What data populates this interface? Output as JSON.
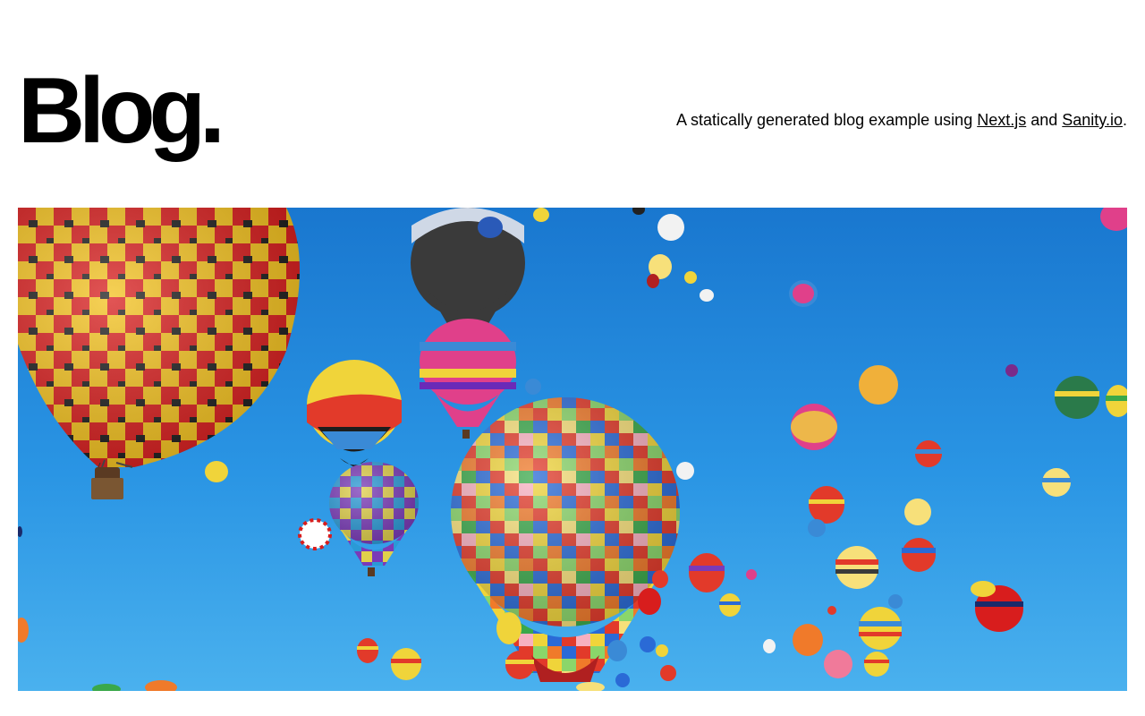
{
  "header": {
    "title": "Blog.",
    "tagline": {
      "prefix": "A statically generated blog example using ",
      "link1": "Next.js",
      "middle": " and ",
      "link2": "Sanity.io",
      "suffix": "."
    }
  },
  "cover_image": {
    "subject": "hot-air-balloons",
    "sky_color": "#2a95e4"
  }
}
